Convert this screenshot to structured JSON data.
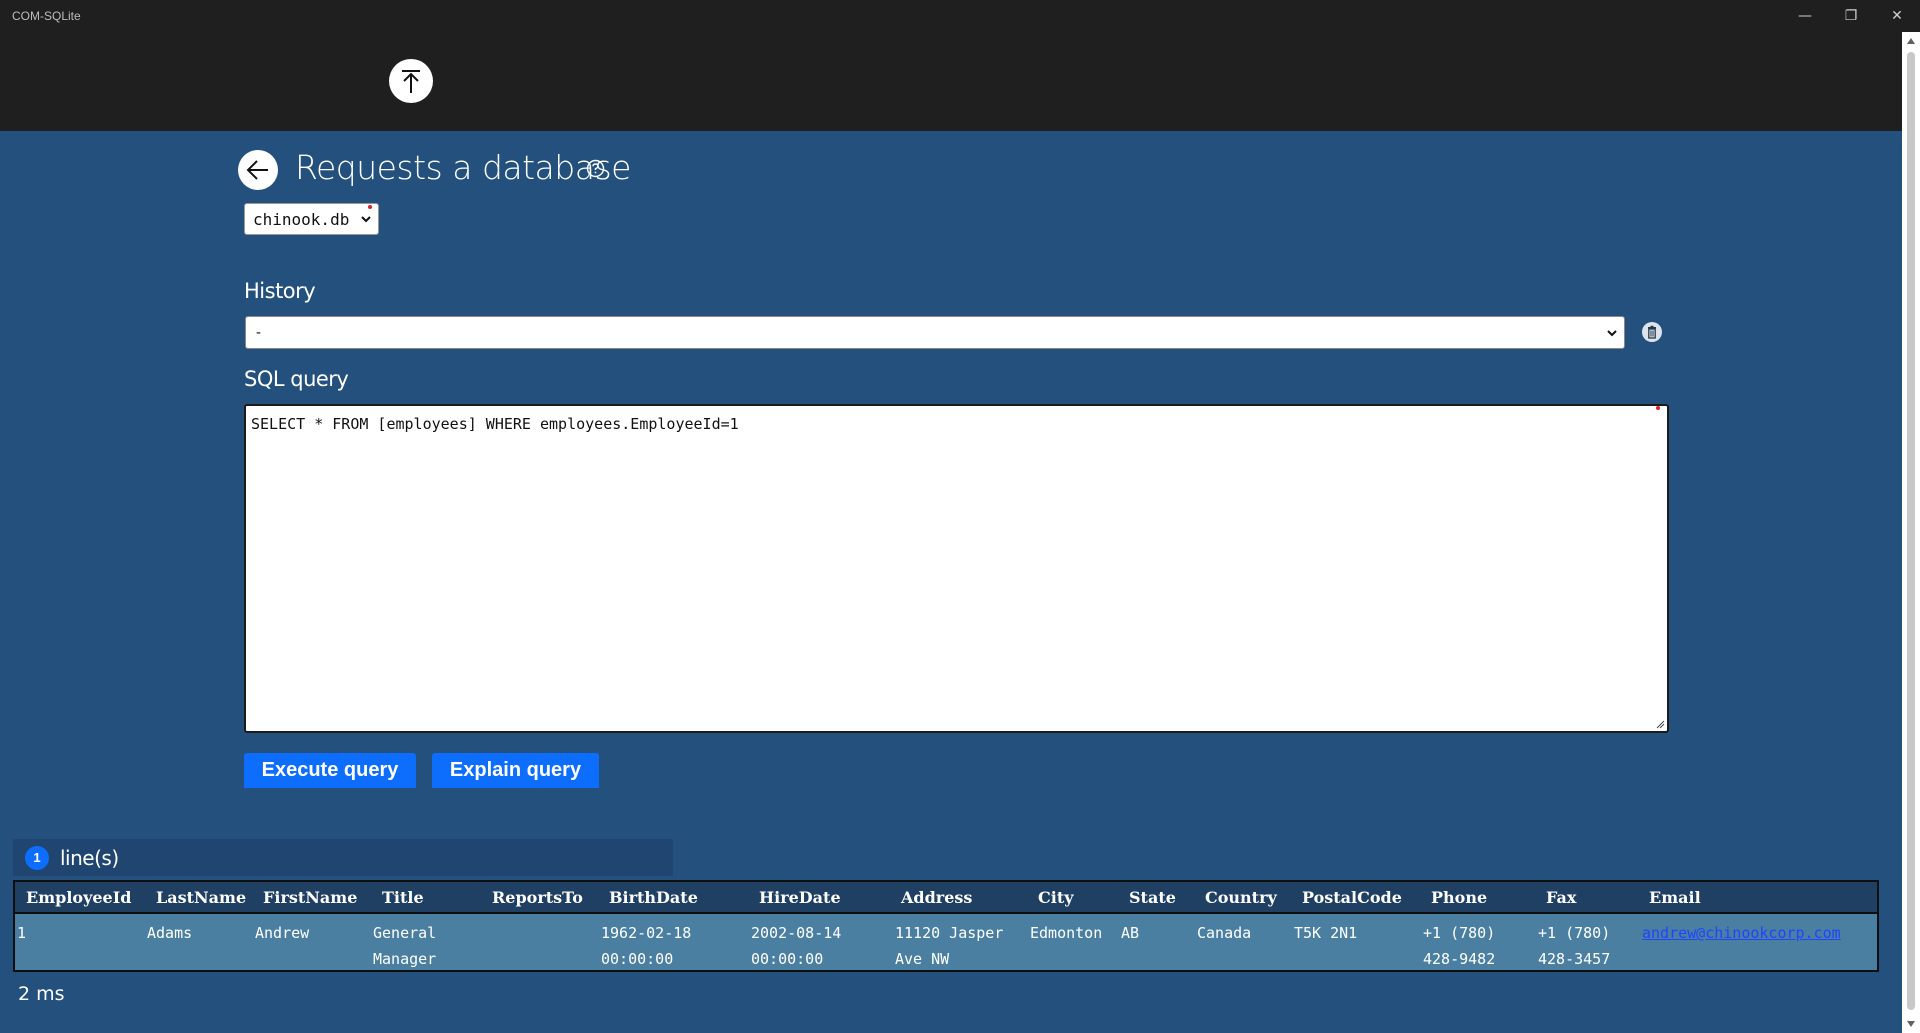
{
  "window": {
    "title": "COM-SQLite",
    "minimize_glyph": "—",
    "restore_glyph": "❐",
    "close_glyph": "✕"
  },
  "header": {
    "upload_icon": "upload-arrow-icon"
  },
  "page": {
    "title": "Requests a database",
    "back_icon": "arrow-left-icon",
    "help_icon": "question-circle-icon"
  },
  "database": {
    "selected": "chinook.db"
  },
  "history": {
    "label": "History",
    "selected": "-",
    "delete_icon": "trash-icon"
  },
  "sql": {
    "label": "SQL query",
    "value": "SELECT * FROM [employees] WHERE employees.EmployeeId=1"
  },
  "actions": {
    "execute_label": "Execute query",
    "explain_label": "Explain query"
  },
  "results": {
    "count": "1",
    "count_label": "line(s)",
    "columns": [
      "EmployeeId",
      "LastName",
      "FirstName",
      "Title",
      "ReportsTo",
      "BirthDate",
      "HireDate",
      "Address",
      "City",
      "State",
      "Country",
      "PostalCode",
      "Phone",
      "Fax",
      "Email"
    ],
    "rows": [
      {
        "EmployeeId": "1",
        "LastName": "Adams",
        "FirstName": "Andrew",
        "Title_1": "General",
        "Title_2": "Manager",
        "ReportsTo": "",
        "BirthDate_1": "1962-02-18",
        "BirthDate_2": "00:00:00",
        "HireDate_1": "2002-08-14",
        "HireDate_2": "00:00:00",
        "Address_1": "11120 Jasper",
        "Address_2": "Ave NW",
        "City": "Edmonton",
        "State": "AB",
        "Country": "Canada",
        "PostalCode": "T5K 2N1",
        "Phone_1": "+1 (780)",
        "Phone_2": "428-9482",
        "Fax_1": "+1 (780)",
        "Fax_2": "428-3457",
        "Email": "andrew@chinookcorp.com"
      }
    ],
    "timing": "2 ms"
  },
  "colors": {
    "background": "#24507d",
    "header": "#1f1f1f",
    "accent": "#0d6efd",
    "table_header": "#1f3f63",
    "table_row": "#4a7fa1",
    "link": "#1f44ff"
  }
}
